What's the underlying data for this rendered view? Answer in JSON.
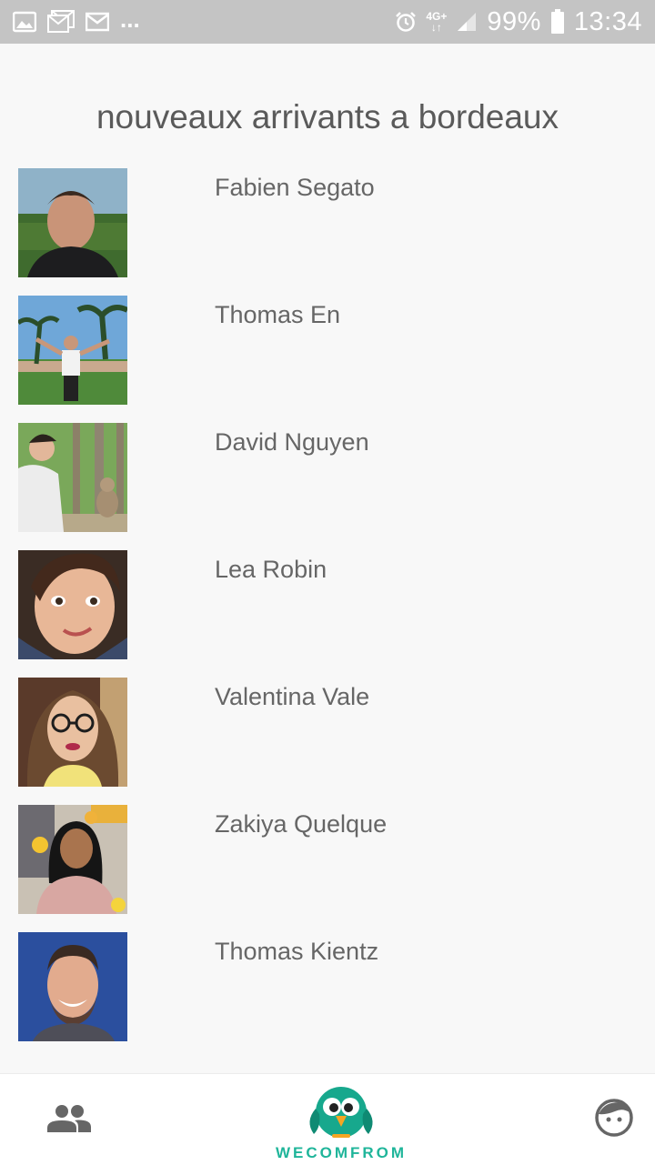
{
  "status_bar": {
    "icons_left": [
      "image-icon",
      "gmail-icon",
      "mail-icon"
    ],
    "overflow": "...",
    "network": "4G+",
    "battery": "99%",
    "time": "13:34"
  },
  "page": {
    "title": "nouveaux arrivants a bordeaux"
  },
  "users": [
    {
      "name": "Fabien Segato"
    },
    {
      "name": "Thomas En"
    },
    {
      "name": "David Nguyen"
    },
    {
      "name": "Lea Robin"
    },
    {
      "name": "Valentina Vale"
    },
    {
      "name": "Zakiya Quelque"
    },
    {
      "name": "Thomas Kientz"
    }
  ],
  "bottom_nav": {
    "brand": "WECOMFROM",
    "left_icon": "people-icon",
    "right_icon": "profile-face-icon",
    "brand_color": "#1fb59a"
  }
}
